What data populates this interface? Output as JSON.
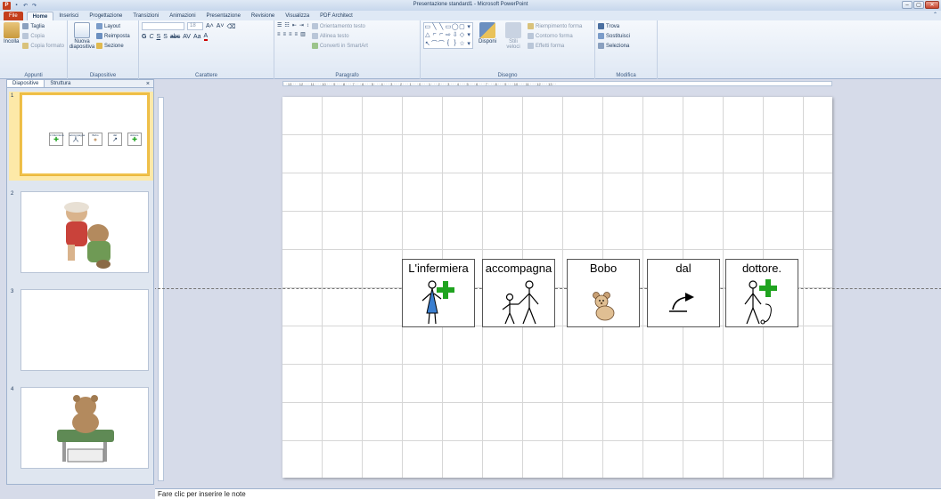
{
  "window": {
    "title": "Presentazione standard1 - Microsoft PowerPoint",
    "app_icon": "P",
    "qat": [
      "save-icon",
      "undo-icon",
      "redo-icon"
    ],
    "controls": [
      "–",
      "▢",
      "✕"
    ]
  },
  "tabs": [
    "File",
    "Home",
    "Inserisci",
    "Progettazione",
    "Transizioni",
    "Animazioni",
    "Presentazione",
    "Revisione",
    "Visualizza",
    "PDF Architect"
  ],
  "ribbon": {
    "appunti": {
      "label": "Appunti",
      "paste": "Incolla",
      "cut": "Taglia",
      "copy": "Copia",
      "format_painter": "Copia formato"
    },
    "diapositive": {
      "label": "Diapositive",
      "new_slide": "Nuova diapositiva",
      "layout": "Layout",
      "reset": "Reimposta",
      "section": "Sezione"
    },
    "carattere": {
      "label": "Carattere",
      "font_size": "18",
      "bold": "G",
      "italic": "C",
      "underline": "S",
      "strike": "abc",
      "spacing": "AV",
      "case": "Aa",
      "font_color": "A"
    },
    "paragrafo": {
      "label": "Paragrafo",
      "text_direction": "Orientamento testo",
      "align_text": "Allinea testo",
      "smartart": "Converti in SmartArt"
    },
    "disegno": {
      "label": "Disegno",
      "arrange": "Disponi",
      "quick_styles": "Stili veloci",
      "shape_fill": "Riempimento forma",
      "shape_outline": "Contorno forma",
      "shape_effects": "Effetti forma"
    },
    "modifica": {
      "label": "Modifica",
      "find": "Trova",
      "replace": "Sostituisci",
      "select": "Seleziona"
    }
  },
  "left_pane": {
    "tabs": [
      "Diapositive",
      "Struttura"
    ],
    "close": "×",
    "slides": [
      {
        "number": "1",
        "selected": true,
        "content": "symbols"
      },
      {
        "number": "2",
        "selected": false,
        "content": "teddy-bears-image"
      },
      {
        "number": "3",
        "selected": false,
        "content": "blank"
      },
      {
        "number": "4",
        "selected": false,
        "content": "teddy-bear-image"
      }
    ],
    "thumb_words": [
      "L'infermiera",
      "accompagna",
      "Bobo",
      "dal",
      "dottore."
    ]
  },
  "ruler_text": "· · 13 · · · 12 · · · 11 · · · 10 · · · 9 · · · 8 · · · 7 · · · 6 · · · 5 · · · 4 · · · 3 · · · 2 · · · 1 · · · 0 · · · 1 · · · 2 · · · 3 · · · 4 · · · 5 · · · 6 · · · 7 · · · 8 · · · 9 · · · 10 · · · 11 · · · 12 · · · 13 · ·",
  "slide": {
    "symbols": [
      {
        "word": "L'infermiera",
        "icon": "nurse-icon"
      },
      {
        "word": "accompagna",
        "icon": "accompany-icon"
      },
      {
        "word": "Bobo",
        "icon": "teddy-bear-icon"
      },
      {
        "word": "dal",
        "icon": "from-arrow-icon"
      },
      {
        "word": "dottore.",
        "icon": "doctor-icon"
      }
    ]
  },
  "notes": {
    "placeholder": "Fare clic per inserire le note"
  },
  "colors": {
    "file_tab": "#c43e1c",
    "cross_green": "#1fa31f",
    "nurse_blue": "#3b7fd0",
    "selection": "#f0c14b"
  }
}
